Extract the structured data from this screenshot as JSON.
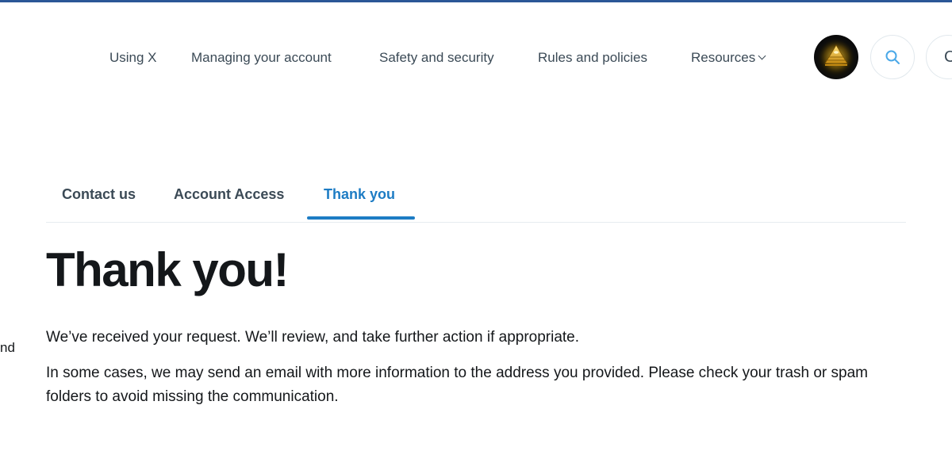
{
  "nav": {
    "items": [
      {
        "label": "Using X"
      },
      {
        "label": "Managing your account"
      },
      {
        "label": "Safety and security"
      },
      {
        "label": "Rules and policies"
      },
      {
        "label": "Resources"
      }
    ]
  },
  "icons": {
    "avatar": "golden-pyramid-avatar",
    "search": "search-icon",
    "dropdown": "chevron-down-icon"
  },
  "header_extra_glyph": "C",
  "tabs": [
    {
      "label": "Contact us"
    },
    {
      "label": "Account Access"
    },
    {
      "label": "Thank you",
      "active": true
    }
  ],
  "content": {
    "title": "Thank you!",
    "paragraph_1": "We’ve received your request. We’ll review, and take further action if appropriate.",
    "paragraph_2": "In some cases, we may send an email with more information to the address you provided. Please check your trash or spam folders to avoid missing the communication."
  },
  "left_edge_fragment": "nd",
  "colors": {
    "top_bar": "#2b5797",
    "accent": "#1d7cc4",
    "nav_text": "#3b4a56",
    "body_text": "#14171a",
    "search_icon": "#4aa8e8",
    "divider": "#e6ecf0"
  }
}
